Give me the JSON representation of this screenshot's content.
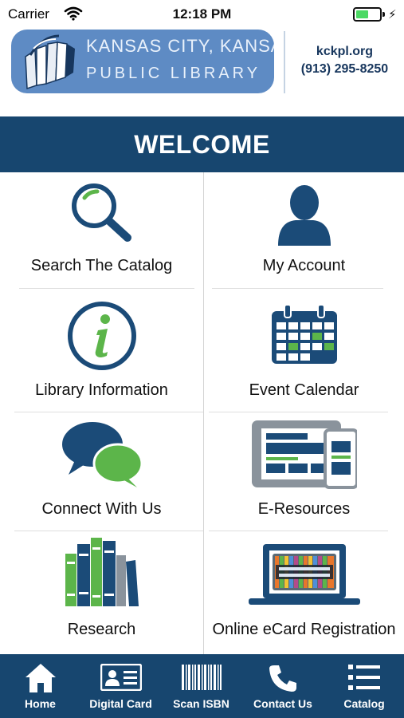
{
  "status_bar": {
    "carrier": "Carrier",
    "time": "12:18 PM",
    "battery_level": 0.55
  },
  "header": {
    "logo_line1": "KANSAS CITY, KANSAS",
    "logo_line2": "PUBLIC LIBRARY",
    "website": "kckpl.org",
    "phone": "(913) 295-8250"
  },
  "welcome": "WELCOME",
  "tiles": [
    {
      "label": "Search The Catalog",
      "icon": "magnifier-icon"
    },
    {
      "label": "My Account",
      "icon": "person-icon"
    },
    {
      "label": "Library Information",
      "icon": "info-icon"
    },
    {
      "label": "Event Calendar",
      "icon": "calendar-icon"
    },
    {
      "label": "Connect With Us",
      "icon": "chat-bubbles-icon"
    },
    {
      "label": "E-Resources",
      "icon": "devices-icon"
    },
    {
      "label": "Research",
      "icon": "books-icon"
    },
    {
      "label": "Online eCard Registration",
      "icon": "laptop-icon"
    }
  ],
  "tabbar": [
    {
      "label": "Home",
      "icon": "home-icon"
    },
    {
      "label": "Digital Card",
      "icon": "id-card-icon"
    },
    {
      "label": "Scan ISBN",
      "icon": "barcode-icon"
    },
    {
      "label": "Contact Us",
      "icon": "phone-icon"
    },
    {
      "label": "Catalog",
      "icon": "list-icon"
    }
  ],
  "colors": {
    "brand_navy": "#17466f",
    "icon_navy": "#1b4b78",
    "accent_green": "#5cb54a",
    "logo_blue": "#5e8bc4"
  }
}
